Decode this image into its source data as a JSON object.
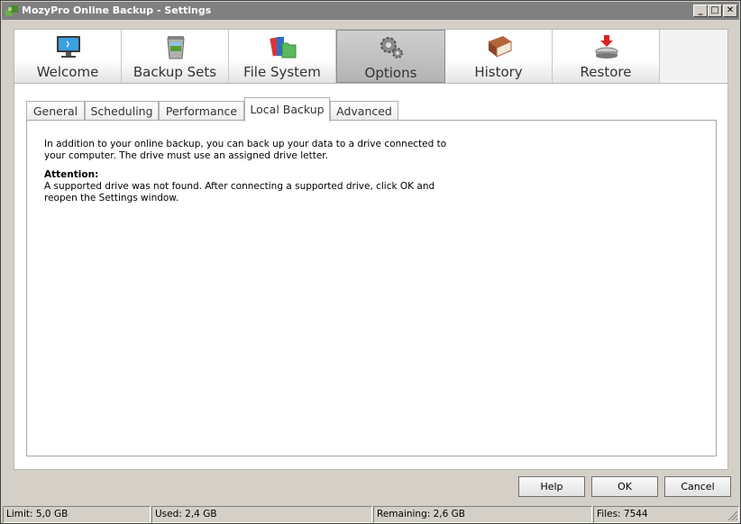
{
  "window": {
    "title": "MozyPro Online Backup - Settings",
    "controls": {
      "minimize": "_",
      "maximize": "□",
      "close": "✕"
    }
  },
  "toolbar": {
    "items": [
      {
        "label": "Welcome",
        "icon": "monitor-icon"
      },
      {
        "label": "Backup Sets",
        "icon": "trash-bin-image-icon"
      },
      {
        "label": "File System",
        "icon": "folders-icon"
      },
      {
        "label": "Options",
        "icon": "gears-icon",
        "active": true
      },
      {
        "label": "History",
        "icon": "book-icon"
      },
      {
        "label": "Restore",
        "icon": "restore-drive-icon"
      }
    ]
  },
  "subtabs": {
    "items": [
      {
        "label": "General"
      },
      {
        "label": "Scheduling"
      },
      {
        "label": "Performance"
      },
      {
        "label": "Local Backup",
        "active": true
      },
      {
        "label": "Advanced"
      }
    ]
  },
  "local_backup": {
    "intro": "In addition to your online backup, you can back up your data to a drive connected to your computer. The drive must use an assigned drive letter.",
    "attention_heading": "Attention:",
    "attention_text": "A supported drive was not found. After connecting a supported drive, click OK and reopen the Settings window."
  },
  "buttons": {
    "help": "Help",
    "ok": "OK",
    "cancel": "Cancel"
  },
  "statusbar": {
    "limit": "Limit: 5,0 GB",
    "used": "Used: 2,4 GB",
    "remaining": "Remaining: 2,6 GB",
    "files": "Files: 7544"
  },
  "colors": {
    "titlebar": "#808080",
    "active_tab": "#b8b8b8",
    "attention_red": "#cc0000"
  }
}
